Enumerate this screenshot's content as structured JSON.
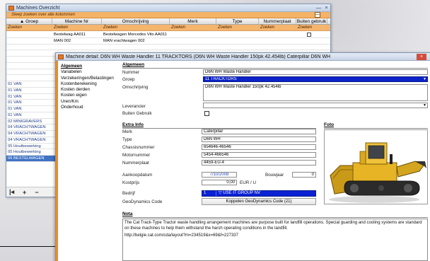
{
  "back_window": {
    "title": "Machines Overzicht",
    "search_hint": "Sleep zoeken over alle kolommen",
    "minimize": "—",
    "close": "×",
    "sort_indicator": "▲",
    "columns": [
      "Groep",
      "Machine Nr",
      "Omschrijving",
      "Merk",
      "Type",
      "Nummerplaat",
      "Buiten gebruik"
    ],
    "filter_label": "Zoeken",
    "rows": [
      {
        "groep": "",
        "mnr": "Bestelwag AA011",
        "oms": "Bestelwagen Mercedes Vito AA011",
        "merk": "",
        "type": "",
        "np": "",
        "bg": true,
        "sel": false
      },
      {
        "groep": "",
        "mnr": "MAN 002",
        "oms": "MAN vrachtwagen 002",
        "merk": "",
        "type": "",
        "np": "",
        "bg": false,
        "sel": false
      },
      {
        "groep": "",
        "mnr": "",
        "oms": "",
        "merk": "",
        "type": "",
        "np": "",
        "bg": false,
        "sel": false
      },
      {
        "groep": "",
        "mnr": "",
        "oms": "",
        "merk": "",
        "type": "",
        "np": "",
        "bg": false,
        "sel": false
      },
      {
        "groep": "",
        "mnr": "",
        "oms": "",
        "merk": "",
        "type": "",
        "np": "",
        "bg": false,
        "sel": false
      },
      {
        "groep": "",
        "mnr": "",
        "oms": "",
        "merk": "",
        "type": "",
        "np": "",
        "bg": false,
        "sel": false
      },
      {
        "groep": "",
        "mnr": "",
        "oms": "",
        "merk": "",
        "type": "",
        "np": "",
        "bg": false,
        "sel": false
      },
      {
        "groep": "",
        "mnr": "",
        "oms": "",
        "merk": "",
        "type": "",
        "np": "",
        "bg": false,
        "sel": false
      },
      {
        "groep": "01 VAN",
        "mnr": "",
        "oms": "",
        "merk": "",
        "type": "",
        "np": "",
        "bg": false,
        "sel": false
      },
      {
        "groep": "01 VAN",
        "mnr": "",
        "oms": "",
        "merk": "",
        "type": "",
        "np": "",
        "bg": false,
        "sel": false
      },
      {
        "groep": "01 VAN",
        "mnr": "",
        "oms": "",
        "merk": "",
        "type": "",
        "np": "",
        "bg": false,
        "sel": false
      },
      {
        "groep": "01 VAN",
        "mnr": "",
        "oms": "",
        "merk": "",
        "type": "",
        "np": "",
        "bg": false,
        "sel": false
      },
      {
        "groep": "01 VAN",
        "mnr": "",
        "oms": "",
        "merk": "",
        "type": "",
        "np": "",
        "bg": false,
        "sel": false
      },
      {
        "groep": "01 VAN",
        "mnr": "",
        "oms": "",
        "merk": "",
        "type": "",
        "np": "",
        "bg": false,
        "sel": false
      },
      {
        "groep": "02 MINIGRAVERS",
        "mnr": "",
        "oms": "",
        "merk": "",
        "type": "",
        "np": "",
        "bg": false,
        "sel": false
      },
      {
        "groep": "04 VRACHTWAGEN",
        "mnr": "",
        "oms": "",
        "merk": "",
        "type": "",
        "np": "",
        "bg": false,
        "sel": false
      },
      {
        "groep": "04 VRACHTWAGEN",
        "mnr": "",
        "oms": "",
        "merk": "",
        "type": "",
        "np": "",
        "bg": false,
        "sel": false
      },
      {
        "groep": "04 VRACHTWAGEN",
        "mnr": "",
        "oms": "",
        "merk": "",
        "type": "",
        "np": "",
        "bg": false,
        "sel": false
      },
      {
        "groep": "05 Houtbewerking",
        "mnr": "",
        "oms": "",
        "merk": "",
        "type": "",
        "np": "",
        "bg": false,
        "sel": false
      },
      {
        "groep": "05 Houtbewerking",
        "mnr": "",
        "oms": "",
        "merk": "",
        "type": "",
        "np": "",
        "bg": false,
        "sel": false
      },
      {
        "groep": "06 BESTELWAGEN",
        "mnr": "",
        "oms": "",
        "merk": "",
        "type": "",
        "np": "",
        "bg": false,
        "sel": true
      }
    ],
    "pager": [
      "|◂",
      "+",
      "−"
    ]
  },
  "detail_window": {
    "title": "Machine detail: D6N WH Waste Handler 11 TRACKTORS (D6N WH Waste Handler 150pk 42.454lb)   Caterpillar D6N WH",
    "close": "×",
    "nav": [
      "Algemeen",
      "Variabelen",
      "Verzekeringen/Belastingen",
      "Kostenberekening",
      "Kosten derden",
      "Kosten eigen",
      "Uren/Km",
      "Onderhoud"
    ],
    "algemeen": {
      "header": "Algemeen",
      "nummer_label": "Nummer",
      "nummer": "D6N WH Waste Handler",
      "groep_label": "Groep",
      "groep": "11 TRACKTORS",
      "omschrijving_label": "Omschrijving",
      "omschrijving": "D6N WH Waste Handler 150pk 42.454lb",
      "leverancier_label": "Leverancier",
      "leverancier": "",
      "buiten_label": "Buiten Gebruik"
    },
    "extra": {
      "header": "Extra Info",
      "merk_label": "Merk",
      "merk": "Caterpillar",
      "type_label": "Type",
      "type": "D6N WH",
      "chassis_label": "Chassisnummer",
      "chassis": "654646-46546",
      "motor_label": "Motornummer",
      "motor": "5454-466546",
      "np_label": "Nummerplaat",
      "np": "4459-EU-4",
      "aankoop_label": "Aankoopdatum",
      "aankoop": "7/10/2008",
      "bouwjaar_label": "Bouwjaar",
      "bouwjaar": "0",
      "kostprijs_label": "Kostprijs",
      "kostprijs": "0,00",
      "kostprijs_unit": "EUR / U",
      "bedrijf_label": "Bedrijf",
      "bedrijf_nr": "1",
      "bedrijf": "USE IT GROUP NV",
      "geo_label": "GeoDynamics Code",
      "geo_button": "Koppelen GeoDynamics Code (21)"
    },
    "foto": {
      "header": "Foto"
    },
    "nota": {
      "header": "Nota",
      "text": "The Cat Track-Type Tractor waste handling arrangement machines are purpose built for landfill operations. Special guarding and cooling systems are standard on these machines to help them withstand the harsh operating conditions in the landfill.",
      "link": "http://belgie.cat.com/cda/layout?m=234519&x=69&f=227337"
    }
  }
}
